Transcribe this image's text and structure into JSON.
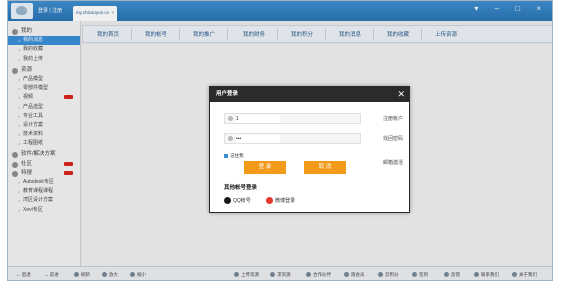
{
  "titlebar": {
    "login_link": "登录",
    "separator": "|",
    "register_link": "注册",
    "url_tab": "my.zhizaoyun.cn",
    "window_controls": "▾ – □ ×"
  },
  "sidebar": {
    "sections": [
      {
        "label": "我的",
        "icon": "user-icon",
        "items": [
          {
            "label": "我的消息",
            "active": true,
            "hot": false
          },
          {
            "label": "我的收藏",
            "hot": false
          },
          {
            "label": "我的上传",
            "hot": false
          }
        ]
      },
      {
        "label": "资源",
        "icon": "resource-icon",
        "items": [
          {
            "label": "产品模型",
            "hot": false
          },
          {
            "label": "零部件模型",
            "hot": false
          },
          {
            "label": "视频",
            "hot": true
          },
          {
            "label": "产品选型",
            "hot": false
          },
          {
            "label": "专业工具",
            "hot": false
          },
          {
            "label": "设计方案",
            "hot": false
          },
          {
            "label": "技术资料",
            "hot": false
          },
          {
            "label": "工程图纸",
            "hot": false
          }
        ]
      },
      {
        "label": "软件/解决方案",
        "icon": "software-icon",
        "items": []
      },
      {
        "label": "社区",
        "icon": "community-icon",
        "hot": true,
        "items": []
      },
      {
        "label": "特搜",
        "icon": "special-icon",
        "hot": true,
        "items": [
          {
            "label": "Autodesk专区",
            "hot": false
          },
          {
            "label": "教育课程课程",
            "hot": false
          },
          {
            "label": "湾区设计方案",
            "hot": false
          },
          {
            "label": "Xevi专区",
            "hot": false
          }
        ]
      }
    ]
  },
  "menu": {
    "items": [
      "我的首页",
      "我的帐号",
      "我的推广",
      "我的财务",
      "我的积分",
      "我的消息",
      "我的收藏",
      "上传资源"
    ]
  },
  "dialog": {
    "title": "用户登录",
    "close": "✕",
    "username_value": "1",
    "password_value": "•••",
    "register_link": "注册帐户",
    "forgot_link": "找回密码",
    "remember_label": "记住我",
    "email_activate_link": "邮箱激活",
    "login_button": "登 录",
    "cancel_button": "取 消",
    "other_title": "其他帐号登录",
    "qq_label": "QQ帐号",
    "weibo_label": "微博登录"
  },
  "bottombar": {
    "back": "后退",
    "forward": "前进",
    "refresh": "刷新",
    "zoom_in": "放大",
    "zoom_out": "缩小",
    "upload": "上传资源",
    "require": "求资源",
    "cooperate": "合作伙伴",
    "member": "隐会员",
    "points": "云积分",
    "sign": "签到",
    "feedback": "反馈",
    "contact": "联系我们",
    "about": "关于我们"
  },
  "colors": {
    "titlebar": "#2a74b6",
    "active_nav": "#3a8fd8",
    "dialog_title": "#2b2b2b",
    "button": "#f39a1b",
    "hot_badge": "#d9241c"
  }
}
